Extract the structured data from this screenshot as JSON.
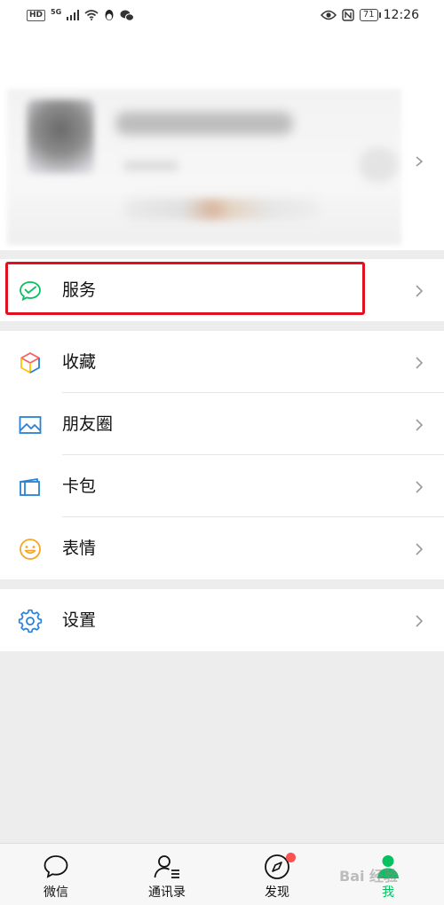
{
  "status_bar": {
    "hd": "HD",
    "network": "5G",
    "battery": "71",
    "time": "12:26"
  },
  "menu": {
    "service": {
      "label": "服务",
      "icon": "wechat-pay-icon"
    },
    "items": [
      {
        "label": "收藏",
        "icon": "favorites-cube-icon"
      },
      {
        "label": "朋友圈",
        "icon": "moments-image-icon"
      },
      {
        "label": "卡包",
        "icon": "card-wallet-icon"
      },
      {
        "label": "表情",
        "icon": "smiley-icon"
      }
    ],
    "settings": {
      "label": "设置",
      "icon": "gear-icon"
    }
  },
  "tabbar": {
    "tabs": [
      {
        "label": "微信",
        "icon": "chat-bubble-icon"
      },
      {
        "label": "通讯录",
        "icon": "contacts-icon"
      },
      {
        "label": "发现",
        "icon": "compass-icon"
      },
      {
        "label": "我",
        "icon": "me-person-icon",
        "active": true
      }
    ]
  },
  "watermark": "Bai 经验",
  "colors": {
    "accent": "#07c160",
    "highlight": "#e0101e",
    "badge": "#fa5151",
    "background": "#ededed"
  }
}
